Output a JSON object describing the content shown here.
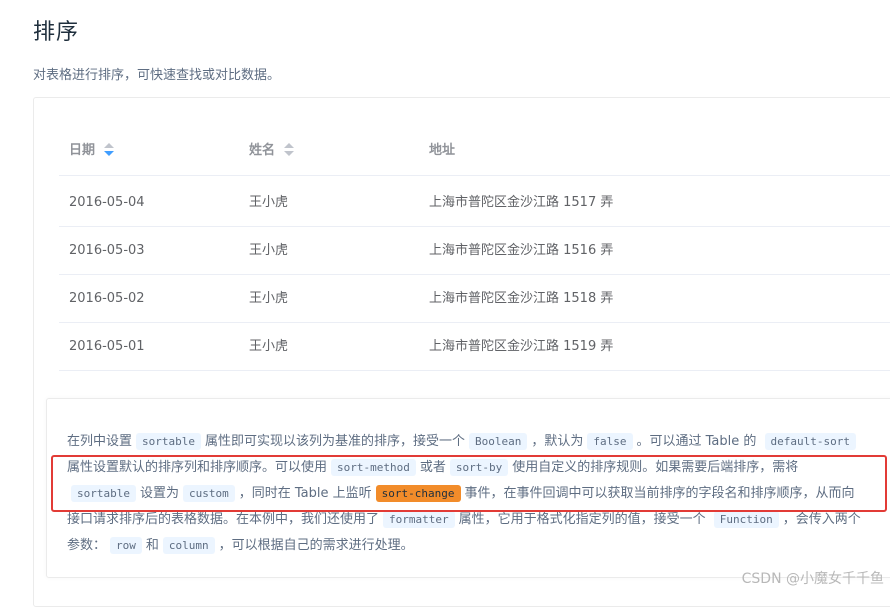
{
  "page": {
    "title": "排序",
    "description": "对表格进行排序，可快速查找或对比数据。"
  },
  "table": {
    "headers": [
      "日期",
      "姓名",
      "地址"
    ],
    "rows": [
      [
        "2016-05-04",
        "王小虎",
        "上海市普陀区金沙江路 1517 弄"
      ],
      [
        "2016-05-03",
        "王小虎",
        "上海市普陀区金沙江路 1516 弄"
      ],
      [
        "2016-05-02",
        "王小虎",
        "上海市普陀区金沙江路 1518 弄"
      ],
      [
        "2016-05-01",
        "王小虎",
        "上海市普陀区金沙江路 1519 弄"
      ]
    ],
    "sort_icons": [
      "sort-caret-icon",
      "sort-caret-icon"
    ]
  },
  "description_block": {
    "t1": "在列中设置",
    "c1": "sortable",
    "t2": "属性即可实现以该列为基准的排序，接受一个",
    "c2": "Boolean",
    "t3": "，默认为",
    "c3": "false",
    "t4": "。可以通过 Table 的",
    "c4": "default-sort",
    "t5": "属性设置默认的排序列和排序顺序。可以使用",
    "c5": "sort-method",
    "t6": "或者",
    "c6": "sort-by",
    "t7": "使用自定义的排序规则。如果需要后端排序，需将",
    "c7": "sortable",
    "t8": "设置为",
    "c8": "custom",
    "t9": "，同时在 Table 上监听",
    "c9": "sort-change",
    "t10": "事件，在事件回调中可以获取当前排序的字段名和排序顺序，从而向接口请求排序后的表格数据。在本例中，我们还使用了",
    "c10": "formatter",
    "t11": "属性，它用于格式化指定列的值，接受一个",
    "c11": "Function",
    "t12": "，会传入两个参数：",
    "c12": "row",
    "t13": "和",
    "c13": "column",
    "t14": "，可以根据自己的需求进行处理。"
  },
  "watermark": "CSDN @小魔女千千鱼",
  "colors": {
    "accent": "#409eff",
    "highlight_box": "#e23b36",
    "code_highlight": "#f28c2a"
  }
}
